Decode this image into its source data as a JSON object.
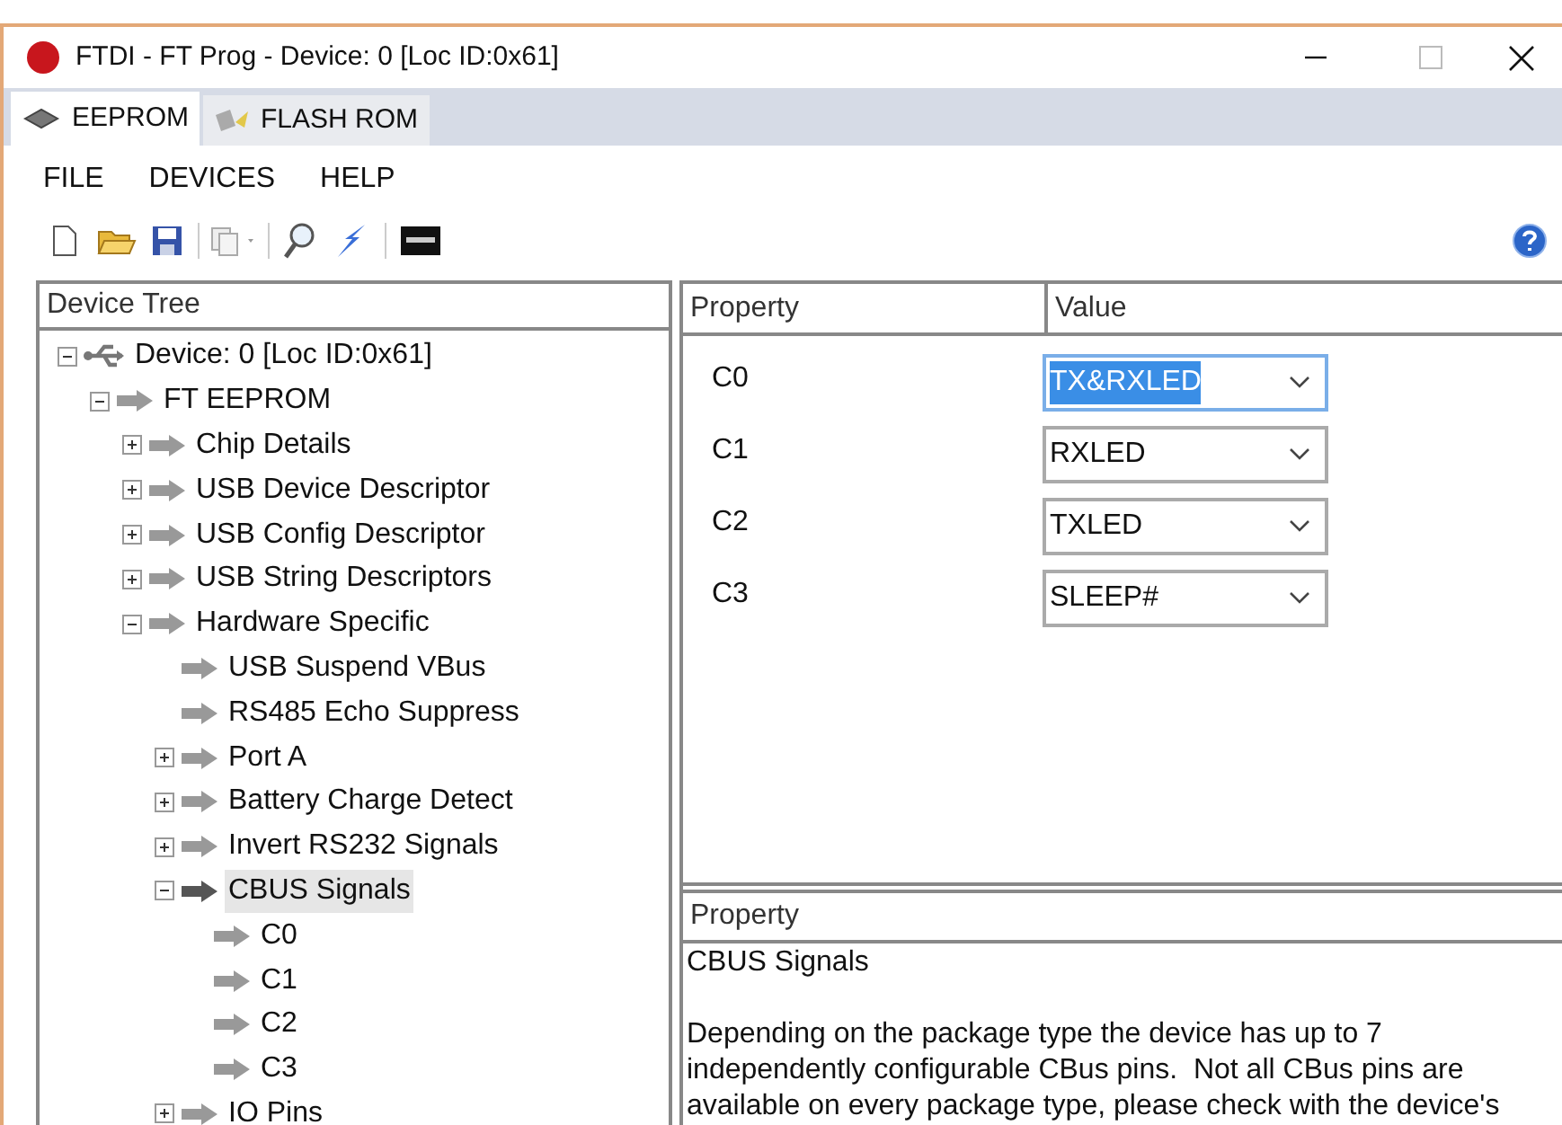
{
  "window": {
    "title": "FTDI - FT Prog - Device: 0 [Loc ID:0x61]"
  },
  "tabs": [
    {
      "label": "EEPROM",
      "selected": true,
      "kind": "chip"
    },
    {
      "label": "FLASH ROM",
      "selected": false,
      "kind": "flash"
    }
  ],
  "menu": [
    "FILE",
    "DEVICES",
    "HELP"
  ],
  "device_tree": {
    "title": "Device Tree",
    "items": [
      {
        "label": "Device: 0 [Loc ID:0x61]",
        "kind": "usb",
        "expanded": true,
        "selected": false,
        "children": [
          {
            "label": "FT EEPROM",
            "kind": "arrow",
            "expanded": true,
            "selected": false,
            "children": [
              {
                "label": "Chip Details",
                "kind": "arrow",
                "expanded": false,
                "selected": false
              },
              {
                "label": "USB Device Descriptor",
                "kind": "arrow",
                "expanded": false,
                "selected": false
              },
              {
                "label": "USB Config Descriptor",
                "kind": "arrow",
                "expanded": false,
                "selected": false
              },
              {
                "label": "USB String Descriptors",
                "kind": "arrow",
                "expanded": false,
                "selected": false
              },
              {
                "label": "Hardware Specific",
                "kind": "arrow",
                "expanded": true,
                "selected": false,
                "children": [
                  {
                    "label": "USB Suspend VBus",
                    "kind": "leaf",
                    "selected": false
                  },
                  {
                    "label": "RS485 Echo Suppress",
                    "kind": "leaf",
                    "selected": false
                  },
                  {
                    "label": "Port A",
                    "kind": "arrow",
                    "expanded": false,
                    "selected": false
                  },
                  {
                    "label": "Battery Charge Detect",
                    "kind": "arrow",
                    "expanded": false,
                    "selected": false
                  },
                  {
                    "label": "Invert RS232 Signals",
                    "kind": "arrow",
                    "expanded": false,
                    "selected": false
                  },
                  {
                    "label": "CBUS Signals",
                    "kind": "arrow",
                    "expanded": true,
                    "selected": true,
                    "children": [
                      {
                        "label": "C0",
                        "kind": "leaf",
                        "selected": false
                      },
                      {
                        "label": "C1",
                        "kind": "leaf",
                        "selected": false
                      },
                      {
                        "label": "C2",
                        "kind": "leaf",
                        "selected": false
                      },
                      {
                        "label": "C3",
                        "kind": "leaf",
                        "selected": false
                      }
                    ]
                  },
                  {
                    "label": "IO Pins",
                    "kind": "arrow",
                    "expanded": false,
                    "selected": false
                  }
                ]
              }
            ]
          }
        ]
      }
    ]
  },
  "property_grid": {
    "columns": [
      "Property",
      "Value"
    ],
    "rows": [
      {
        "property": "C0",
        "value": "TX&RXLED",
        "selected": true
      },
      {
        "property": "C1",
        "value": "RXLED",
        "selected": false
      },
      {
        "property": "C2",
        "value": "TXLED",
        "selected": false
      },
      {
        "property": "C3",
        "value": "SLEEP#",
        "selected": false
      }
    ]
  },
  "description": {
    "header": "Property",
    "title": "CBUS Signals",
    "text": "Depending on the package type the device has up to 7 independently configurable CBus pins.  Not all CBus pins are available on every package type, please check with the device's"
  }
}
